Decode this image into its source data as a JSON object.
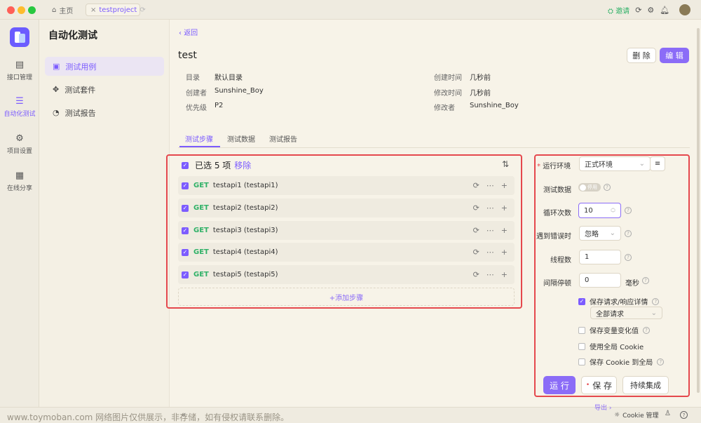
{
  "titlebar": {
    "home": "主页",
    "project_tab": "testproject",
    "invite": "邀请"
  },
  "rail": {
    "items": [
      "接口管理",
      "自动化测试",
      "项目设置",
      "在线分享"
    ]
  },
  "nav": {
    "title": "自动化测试",
    "items": [
      "测试用例",
      "测试套件",
      "测试报告"
    ]
  },
  "header": {
    "back": "返回",
    "name": "test",
    "delete_label": "删 除",
    "edit_label": "编 辑"
  },
  "meta": {
    "dir_label": "目录",
    "dir": "默认目录",
    "creator_label": "创建者",
    "creator": "Sunshine_Boy",
    "priority_label": "优先级",
    "priority": "P2",
    "created_label": "创建时间",
    "created": "几秒前",
    "modified_label": "修改时间",
    "modified": "几秒前",
    "modifier_label": "修改者",
    "modifier": "Sunshine_Boy"
  },
  "tabs": [
    "测试步骤",
    "测试数据",
    "测试报告"
  ],
  "steps": {
    "selected": "已选 5 项",
    "remove": "移除",
    "method": "GET",
    "items": [
      "testapi1 (testapi1)",
      "testapi2 (testapi2)",
      "testapi3 (testapi3)",
      "testapi4 (testapi4)",
      "testapi5 (testapi5)"
    ],
    "add": "+添加步骤"
  },
  "settings": {
    "env_label": "运行环境",
    "env": "正式环境",
    "data_label": "测试数据",
    "data_toggle": "停用",
    "loop_label": "循环次数",
    "loop": "10",
    "error_label": "遇到错误时",
    "error": "忽略",
    "threads_label": "线程数",
    "threads": "1",
    "interval_label": "间隔停顿",
    "interval": "0",
    "interval_unit": "毫秒",
    "save_detail": "保存请求/响应详情",
    "save_detail_checked": true,
    "all_requests": "全部请求",
    "save_var": "保存变量变化值",
    "use_cookie": "使用全局 Cookie",
    "save_cookie": "保存 Cookie 到全局",
    "run": "运 行",
    "save": "保 存",
    "ci": "持续集成"
  },
  "footer": {
    "cookie": "Cookie 管理",
    "export": "导出"
  },
  "watermark": "www.toymoban.com 网络图片仅供展示，非存储，如有侵权请联系删除。"
}
